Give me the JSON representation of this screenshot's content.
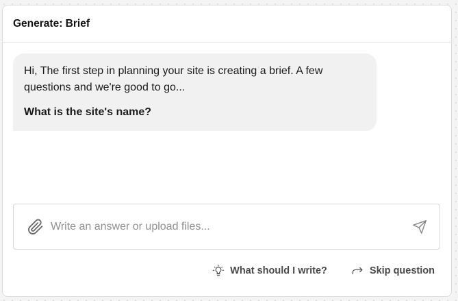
{
  "header": {
    "title": "Generate: Brief"
  },
  "message": {
    "intro": "Hi, The first step in planning your site is creating a brief. A few questions and we're good to go...",
    "question": "What is the site's name?"
  },
  "composer": {
    "placeholder": "Write an answer or upload files...",
    "value": "",
    "attach_icon": "paperclip-icon",
    "send_icon": "send-icon"
  },
  "actions": {
    "hint_label": "What should I write?",
    "hint_icon": "lightbulb-icon",
    "skip_label": "Skip question",
    "skip_icon": "skip-arrow-icon"
  }
}
